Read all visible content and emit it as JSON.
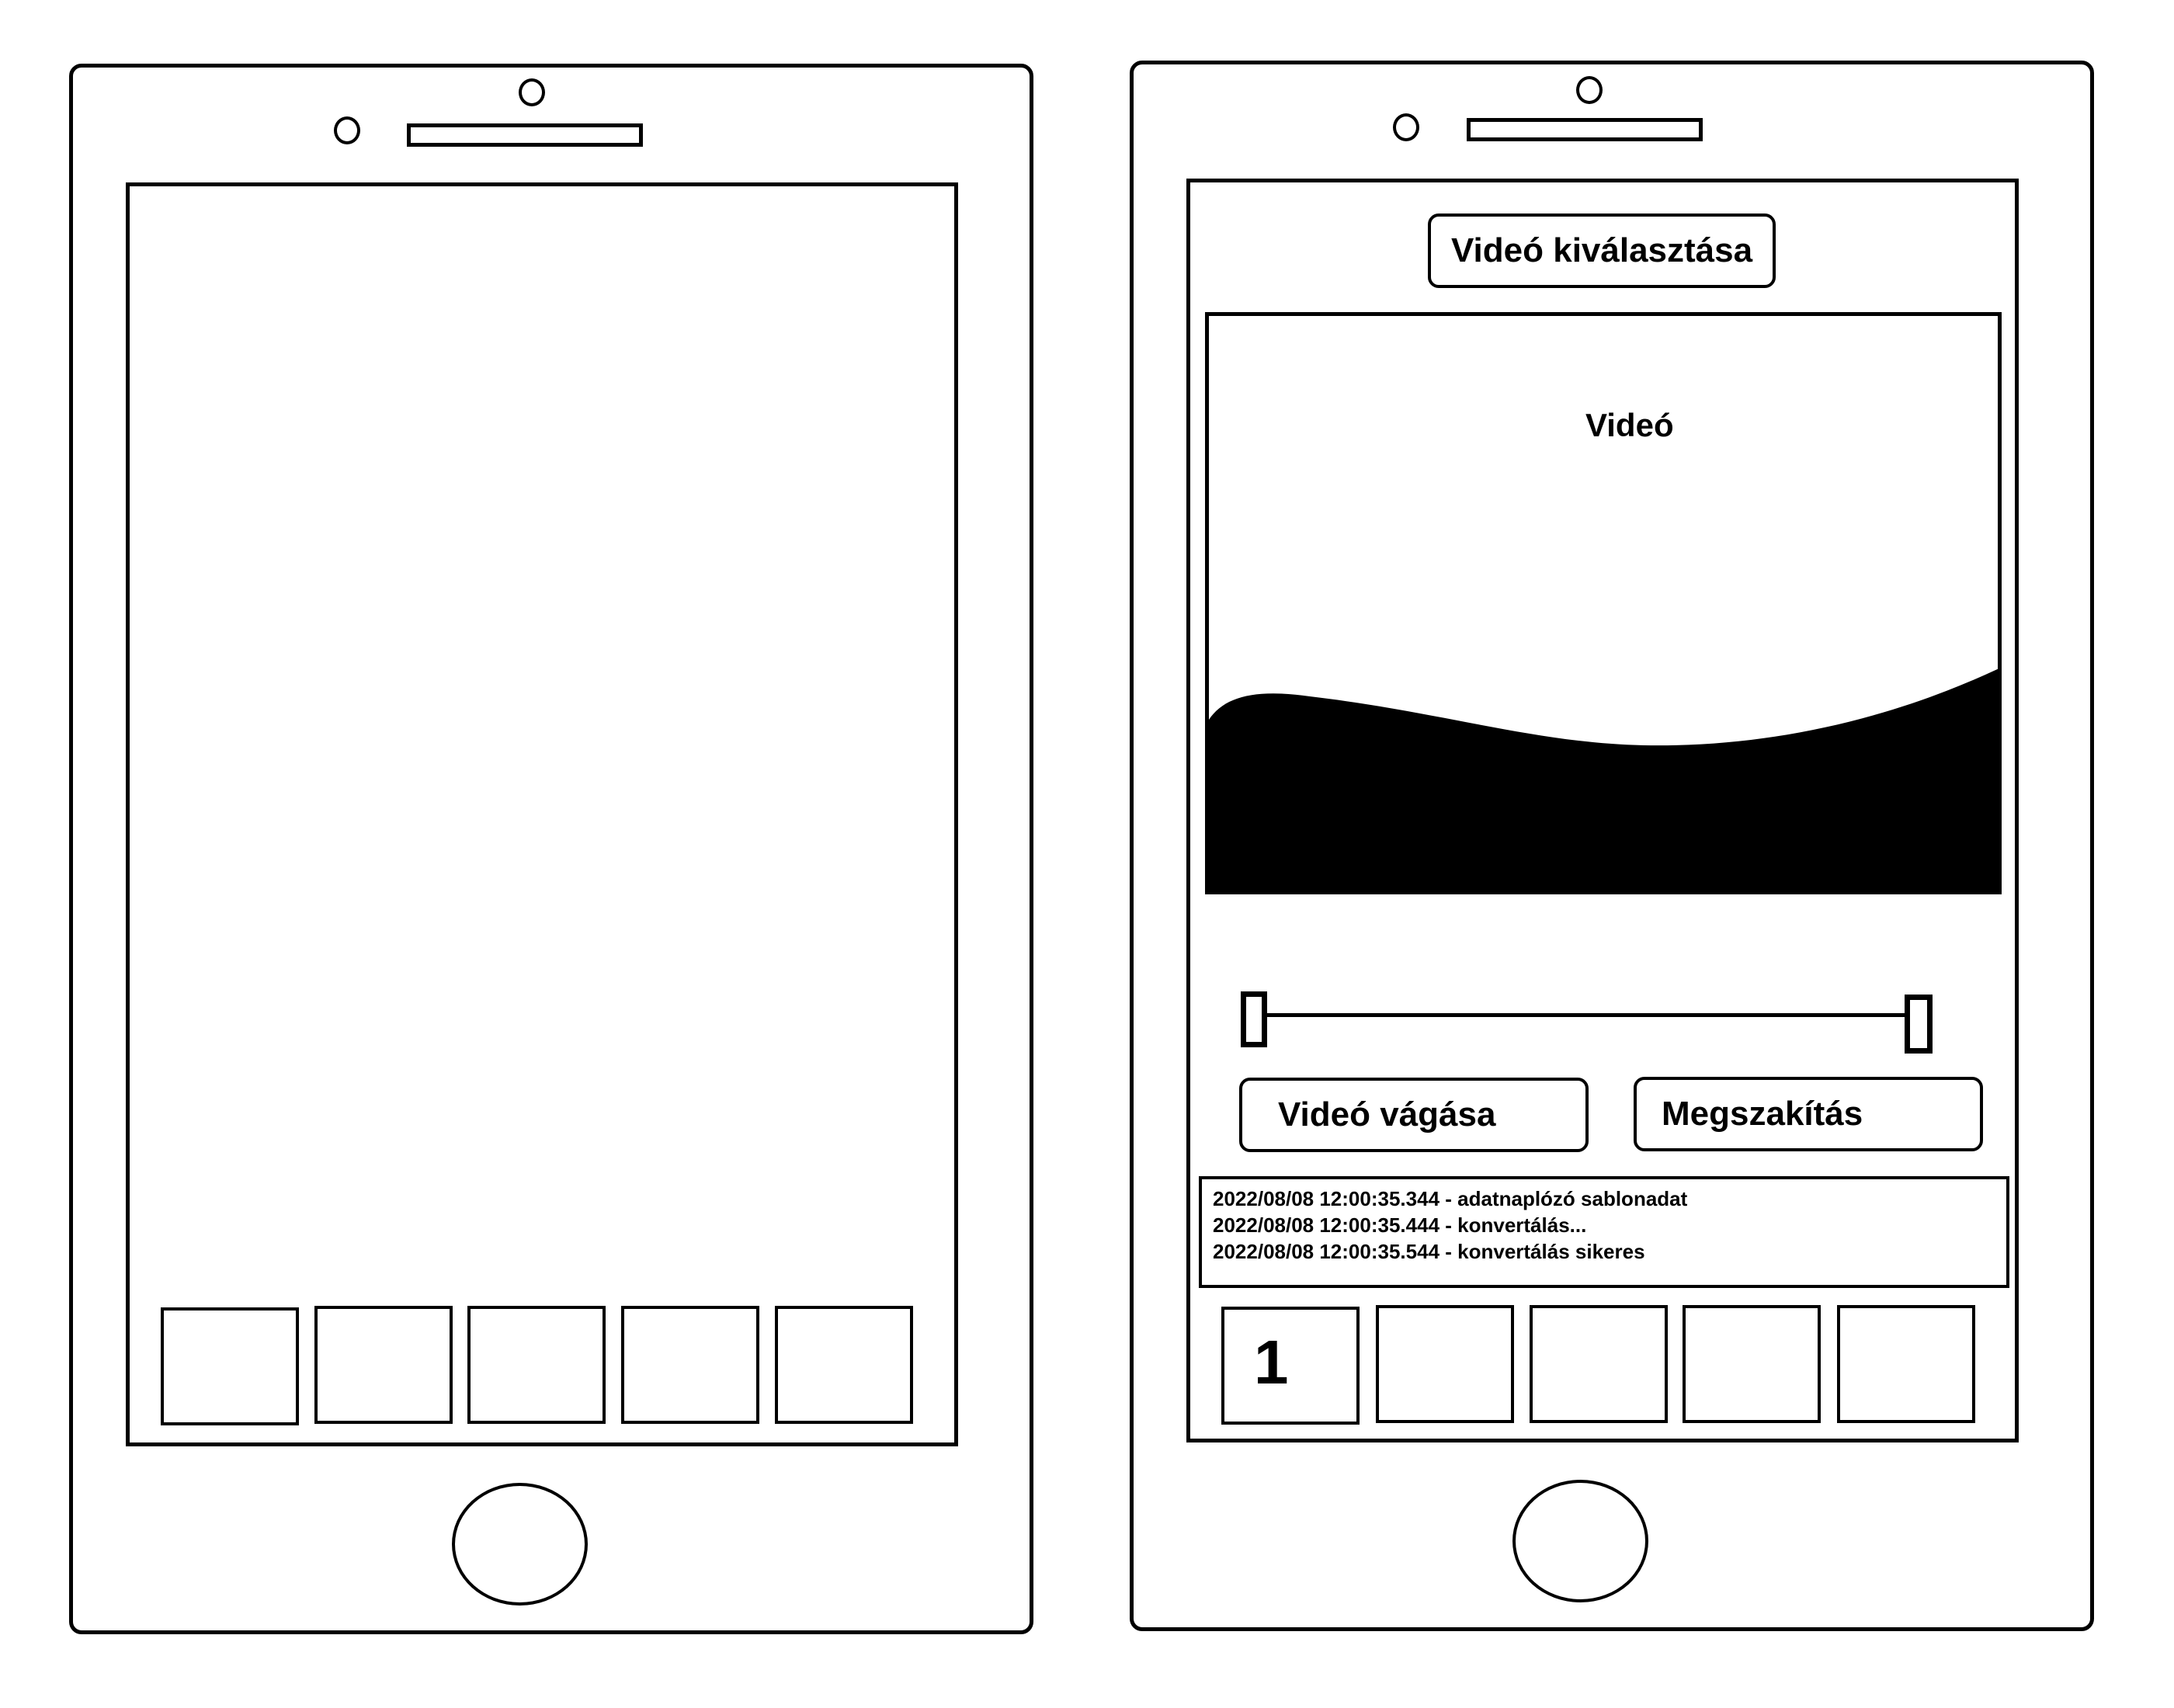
{
  "left_phone": {
    "dock_slots": [
      "",
      "",
      "",
      "",
      ""
    ]
  },
  "right_phone": {
    "select_video_button": "Videó kiválasztása",
    "video_label": "Videó",
    "cut_video_button": "Videó vágása",
    "abort_button": "Megszakítás",
    "log_lines": [
      "2022/08/08 12:00:35.344 - adatnaplózó sablonadat",
      "2022/08/08 12:00:35.444 - konvertálás...",
      "2022/08/08 12:00:35.544 - konvertálás sikeres"
    ],
    "dock_slots": [
      "1",
      "",
      "",
      "",
      ""
    ]
  }
}
